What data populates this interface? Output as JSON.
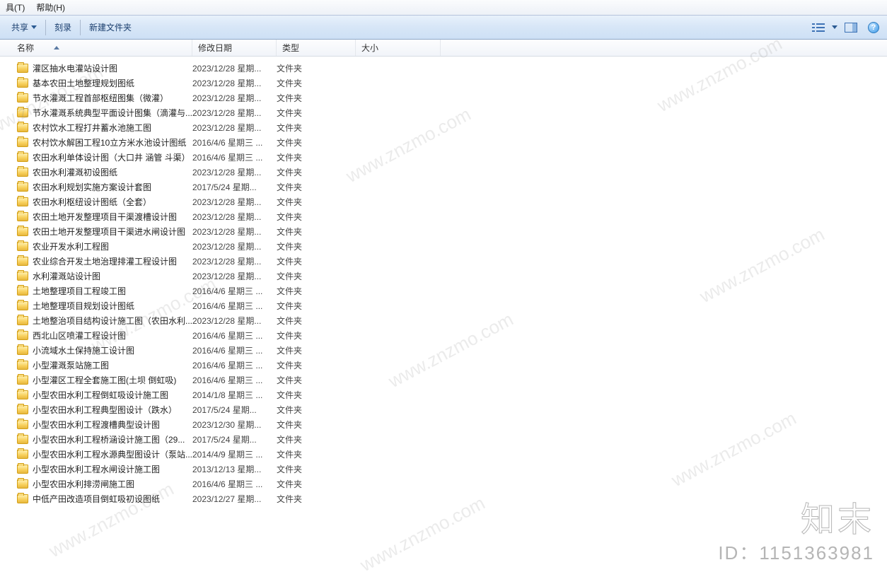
{
  "menubar": {
    "tools": "具(T)",
    "help": "帮助(H)"
  },
  "toolbar": {
    "share": "共享",
    "burn": "刻录",
    "newfolder": "新建文件夹"
  },
  "columns": {
    "name": "名称",
    "date": "修改日期",
    "type": "类型",
    "size": "大小"
  },
  "type_folder": "文件夹",
  "files": [
    {
      "name": "灌区抽水电灌站设计图",
      "date": "2023/12/28 星期..."
    },
    {
      "name": "基本农田土地整理规划图纸",
      "date": "2023/12/28 星期..."
    },
    {
      "name": "节水灌溉工程首部枢纽图集（微灌）",
      "date": "2023/12/28 星期..."
    },
    {
      "name": "节水灌溉系统典型平面设计图集（滴灌与...",
      "date": "2023/12/28 星期..."
    },
    {
      "name": "农村饮水工程打井蓄水池施工图",
      "date": "2023/12/28 星期..."
    },
    {
      "name": "农村饮水解困工程10立方米水池设计图纸",
      "date": "2016/4/6 星期三 ..."
    },
    {
      "name": "农田水利单体设计图（大口井 涵管 斗渠）",
      "date": "2016/4/6 星期三 ..."
    },
    {
      "name": "农田水利灌溉初设图纸",
      "date": "2023/12/28 星期..."
    },
    {
      "name": "农田水利规划实施方案设计套图",
      "date": "2017/5/24 星期..."
    },
    {
      "name": "农田水利枢纽设计图纸（全套）",
      "date": "2023/12/28 星期..."
    },
    {
      "name": "农田土地开发整理项目干渠渡槽设计图",
      "date": "2023/12/28 星期..."
    },
    {
      "name": "农田土地开发整理项目干渠进水闸设计图",
      "date": "2023/12/28 星期..."
    },
    {
      "name": "农业开发水利工程图",
      "date": "2023/12/28 星期..."
    },
    {
      "name": "农业综合开发土地治理排灌工程设计图",
      "date": "2023/12/28 星期..."
    },
    {
      "name": "水利灌溉站设计图",
      "date": "2023/12/28 星期..."
    },
    {
      "name": "土地整理项目工程竣工图",
      "date": "2016/4/6 星期三 ..."
    },
    {
      "name": "土地整理项目规划设计图纸",
      "date": "2016/4/6 星期三 ..."
    },
    {
      "name": "土地整治项目结构设计施工图（农田水利...",
      "date": "2023/12/28 星期..."
    },
    {
      "name": "西北山区喷灌工程设计图",
      "date": "2016/4/6 星期三 ..."
    },
    {
      "name": "小流域水土保持施工设计图",
      "date": "2016/4/6 星期三 ..."
    },
    {
      "name": "小型灌溉泵站施工图",
      "date": "2016/4/6 星期三 ..."
    },
    {
      "name": "小型灌区工程全套施工图(土坝 倒虹吸)",
      "date": "2016/4/6 星期三 ..."
    },
    {
      "name": "小型农田水利工程倒虹吸设计施工图",
      "date": "2014/1/8 星期三 ..."
    },
    {
      "name": "小型农田水利工程典型图设计（跌水）",
      "date": "2017/5/24 星期..."
    },
    {
      "name": "小型农田水利工程渡槽典型设计图",
      "date": "2023/12/30 星期..."
    },
    {
      "name": "小型农田水利工程桥涵设计施工图（29...",
      "date": "2017/5/24 星期..."
    },
    {
      "name": "小型农田水利工程水源典型图设计（泵站...",
      "date": "2014/4/9 星期三 ..."
    },
    {
      "name": "小型农田水利工程水闸设计施工图",
      "date": "2013/12/13 星期..."
    },
    {
      "name": "小型农田水利排涝闸施工图",
      "date": "2016/4/6 星期三 ..."
    },
    {
      "name": "中低产田改造项目倒虹吸初设图纸",
      "date": "2023/12/27 星期..."
    }
  ],
  "watermark": {
    "text": "www.znzmo.com",
    "brand": "知末",
    "id": "ID：1151363981"
  }
}
